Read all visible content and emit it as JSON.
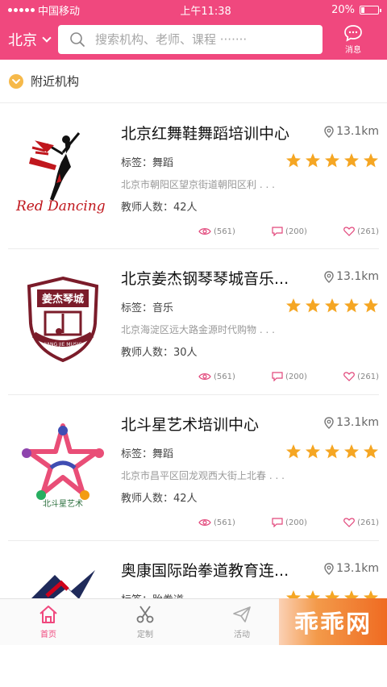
{
  "status_bar": {
    "carrier": "中国移动",
    "time": "上午11:38",
    "battery": "20%"
  },
  "header": {
    "city": "北京",
    "search_placeholder": "搜索机构、老师、课程 ·······",
    "message_label": "消息"
  },
  "section": {
    "title": "附近机构"
  },
  "institutions": [
    {
      "name": "北京红舞鞋舞蹈培训中心",
      "distance": "13.1km",
      "tag": "标签：舞蹈",
      "address": "北京市朝阳区望京街道朝阳区利 . . .",
      "teachers": "教师人数：42人",
      "views": "(561)",
      "comments": "(200)",
      "likes": "(261)",
      "rating": 5,
      "logo_text": "Red Dancing"
    },
    {
      "name": "北京姜杰钢琴琴城音乐...",
      "distance": "13.1km",
      "tag": "标签：音乐",
      "address": "北京海淀区远大路金源时代购物 . . .",
      "teachers": "教师人数：30人",
      "views": "(561)",
      "comments": "(200)",
      "likes": "(261)",
      "rating": 5,
      "logo_text": "姜杰琴城",
      "logo_subtext": "JIANG JIE MUSIC"
    },
    {
      "name": "北斗星艺术培训中心",
      "distance": "13.1km",
      "tag": "标签：舞蹈",
      "address": "北京市昌平区回龙观西大街上北春 . . .",
      "teachers": "教师人数：42人",
      "views": "(561)",
      "comments": "(200)",
      "likes": "(261)",
      "rating": 5,
      "logo_text": "北斗星艺术"
    },
    {
      "name": "奥康国际跆拳道教育连...",
      "distance": "13.1km",
      "tag": "标签：跆拳道",
      "rating": 5
    }
  ],
  "nav": {
    "home": "首页",
    "custom": "定制",
    "activity": "活动"
  },
  "watermark": "乖乖网",
  "colors": {
    "brand": "#f0487e",
    "star": "#f5a623"
  }
}
